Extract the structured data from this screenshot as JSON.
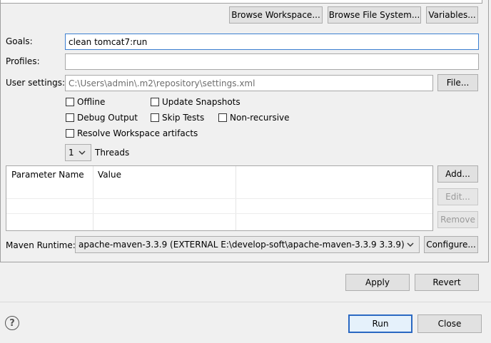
{
  "top_buttons": {
    "browse_workspace": "Browse Workspace...",
    "browse_file_system": "Browse File System...",
    "variables": "Variables..."
  },
  "goals": {
    "label": "Goals:",
    "value": "clean tomcat7:run"
  },
  "profiles": {
    "label": "Profiles:",
    "value": ""
  },
  "user_settings": {
    "label": "User settings:",
    "value": "C:\\Users\\admin\\.m2\\repository\\settings.xml",
    "file_button": "File..."
  },
  "options": {
    "offline": {
      "label": "Offline",
      "checked": false
    },
    "update_snapshots": {
      "label": "Update Snapshots",
      "checked": false
    },
    "debug_output": {
      "label": "Debug Output",
      "checked": false
    },
    "skip_tests": {
      "label": "Skip Tests",
      "checked": false
    },
    "non_recursive": {
      "label": "Non-recursive",
      "checked": false
    },
    "resolve_workspace": {
      "label": "Resolve Workspace artifacts",
      "checked": false
    }
  },
  "threads": {
    "value": "1",
    "label": "Threads"
  },
  "params_table": {
    "columns": [
      "Parameter Name",
      "Value"
    ],
    "rows": []
  },
  "param_buttons": {
    "add": "Add...",
    "edit": "Edit...",
    "remove": "Remove"
  },
  "runtime": {
    "label": "Maven Runtime:",
    "value": "apache-maven-3.3.9 (EXTERNAL E:\\develop-soft\\apache-maven-3.3.9 3.3.9)",
    "configure": "Configure..."
  },
  "apply_revert": {
    "apply": "Apply",
    "revert": "Revert"
  },
  "footer": {
    "help": "?",
    "run": "Run",
    "close": "Close"
  }
}
